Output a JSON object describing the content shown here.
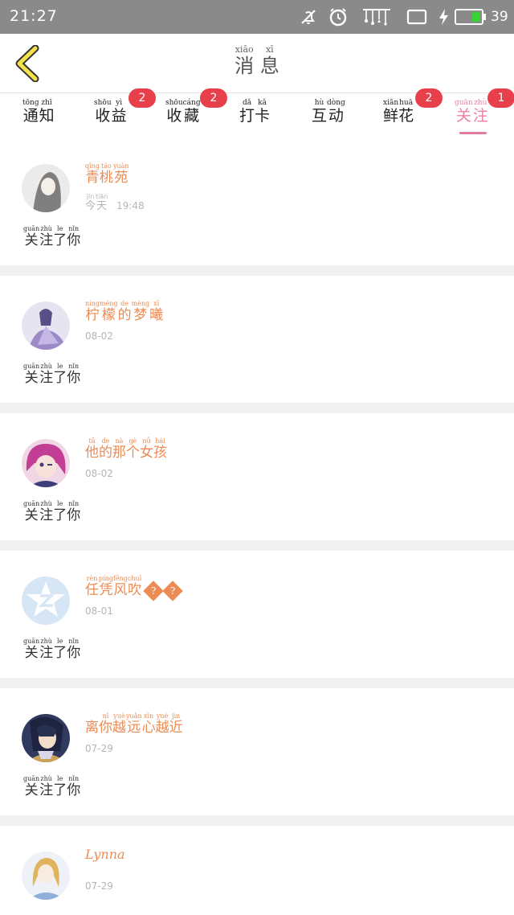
{
  "status_bar": {
    "time": "21:27",
    "battery_percent": "39",
    "icons": [
      "mute-icon",
      "alarm-icon",
      "notification-icon",
      "tablet-icon",
      "charging-icon",
      "battery-icon"
    ]
  },
  "header": {
    "title": [
      {
        "char": "消",
        "pinyin": "xiāo"
      },
      {
        "char": "息",
        "pinyin": "xī"
      }
    ]
  },
  "tabs": [
    {
      "chars": [
        {
          "c": "通",
          "p": "tōng"
        },
        {
          "c": "知",
          "p": "zhī"
        }
      ],
      "badge": "",
      "active": false
    },
    {
      "chars": [
        {
          "c": "收",
          "p": "shōu"
        },
        {
          "c": "益",
          "p": "yì"
        }
      ],
      "badge": "2",
      "active": false
    },
    {
      "chars": [
        {
          "c": "收",
          "p": "shōu"
        },
        {
          "c": "藏",
          "p": "cáng"
        }
      ],
      "badge": "2",
      "active": false
    },
    {
      "chars": [
        {
          "c": "打",
          "p": "dǎ"
        },
        {
          "c": "卡",
          "p": "kǎ"
        }
      ],
      "badge": "",
      "active": false
    },
    {
      "chars": [
        {
          "c": "互",
          "p": "hù"
        },
        {
          "c": "动",
          "p": "dòng"
        }
      ],
      "badge": "",
      "active": false
    },
    {
      "chars": [
        {
          "c": "鲜",
          "p": "xiān"
        },
        {
          "c": "花",
          "p": "huā"
        }
      ],
      "badge": "2",
      "active": false
    },
    {
      "chars": [
        {
          "c": "关",
          "p": "guān"
        },
        {
          "c": "注",
          "p": "zhù"
        }
      ],
      "badge": "1",
      "active": true
    }
  ],
  "follow_message": [
    {
      "c": "关",
      "p": "guān"
    },
    {
      "c": "注",
      "p": "zhù"
    },
    {
      "c": "了",
      "p": "le"
    },
    {
      "c": "你",
      "p": "nǐn"
    }
  ],
  "items": [
    {
      "name": [
        {
          "c": "青",
          "p": "qīng"
        },
        {
          "c": "桃",
          "p": "táo"
        },
        {
          "c": "苑",
          "p": "yuàn"
        }
      ],
      "date_ruby": [
        {
          "c": "今",
          "p": "jīn"
        },
        {
          "c": "天",
          "p": "tiān"
        }
      ],
      "date_time": "19:48",
      "avatar_colors": [
        "#e8e8e8",
        "#6b6b6b"
      ]
    },
    {
      "name": [
        {
          "c": "柠",
          "p": "níng"
        },
        {
          "c": "檬",
          "p": "méng"
        },
        {
          "c": "的",
          "p": "de"
        },
        {
          "c": "梦",
          "p": "mèng"
        },
        {
          "c": "曦",
          "p": "xī"
        }
      ],
      "date_time": "08-02",
      "avatar_colors": [
        "#d8d4ec",
        "#8a76b8"
      ]
    },
    {
      "name": [
        {
          "c": "他",
          "p": "tā"
        },
        {
          "c": "的",
          "p": "de"
        },
        {
          "c": "那",
          "p": "nà"
        },
        {
          "c": "个",
          "p": "gè"
        },
        {
          "c": "女",
          "p": "nǚ"
        },
        {
          "c": "孩",
          "p": "hái"
        }
      ],
      "date_time": "08-02",
      "avatar_colors": [
        "#c94aa0",
        "#3d3d7a"
      ]
    },
    {
      "name": [
        {
          "c": "任",
          "p": "rèn"
        },
        {
          "c": "凭",
          "p": "píng"
        },
        {
          "c": "风",
          "p": "fēng"
        },
        {
          "c": "吹",
          "p": "chuī"
        }
      ],
      "name_suffix": [
        "?",
        "?"
      ],
      "date_time": "08-01",
      "avatar_colors": [
        "#d6e6f4",
        "#ffffff"
      ]
    },
    {
      "name": [
        {
          "c": "离",
          "p": ""
        },
        {
          "c": "你",
          "p": "nǐ"
        },
        {
          "c": "越",
          "p": "yuè"
        },
        {
          "c": "远",
          "p": "yuǎn"
        },
        {
          "c": "心",
          "p": "xīn"
        },
        {
          "c": "越",
          "p": "yuè"
        },
        {
          "c": "近",
          "p": "jìn"
        }
      ],
      "date_time": "07-29",
      "avatar_colors": [
        "#3b3b6e",
        "#c9a35a"
      ]
    },
    {
      "name_latin": "Lynna",
      "date_time": "07-29",
      "avatar_colors": [
        "#e8eef6",
        "#e0b45c"
      ]
    }
  ],
  "colors": {
    "status_bar_bg": "#8a8a8a",
    "accent_pink": "#ea7fa6",
    "badge_red": "#e8404a",
    "name_orange": "#ec8b53",
    "back_arrow_yellow": "#f3e24a"
  }
}
